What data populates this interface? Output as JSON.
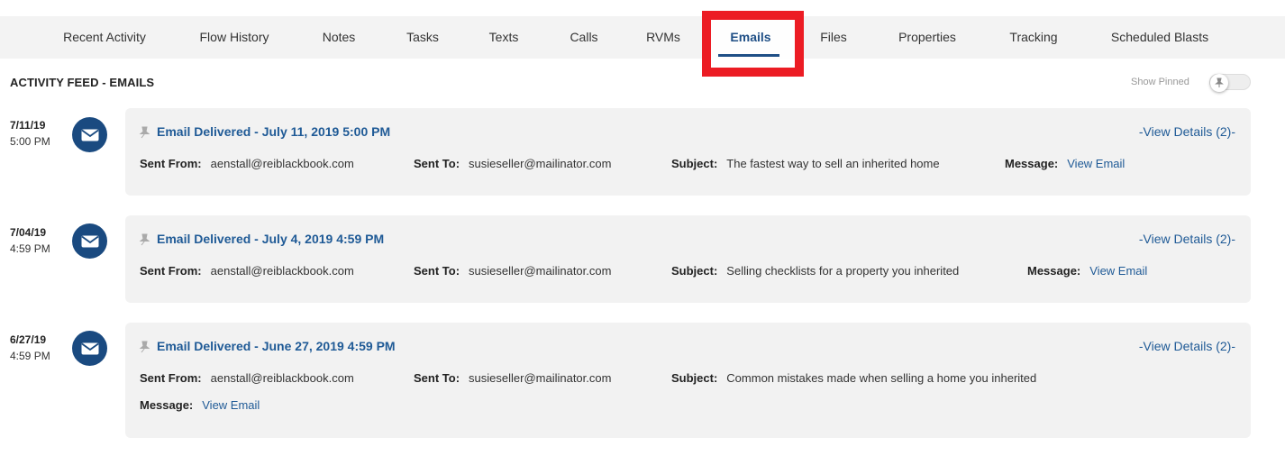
{
  "tabs": [
    {
      "label": "Recent Activity",
      "active": false
    },
    {
      "label": "Flow History",
      "active": false
    },
    {
      "label": "Notes",
      "active": false
    },
    {
      "label": "Tasks",
      "active": false
    },
    {
      "label": "Texts",
      "active": false
    },
    {
      "label": "Calls",
      "active": false
    },
    {
      "label": "RVMs",
      "active": false
    },
    {
      "label": "Emails",
      "active": true
    },
    {
      "label": "Files",
      "active": false
    },
    {
      "label": "Properties",
      "active": false
    },
    {
      "label": "Tracking",
      "active": false
    },
    {
      "label": "Scheduled Blasts",
      "active": false
    }
  ],
  "feed": {
    "title": "ACTIVITY FEED - EMAILS",
    "show_pinned_label": "Show Pinned",
    "show_pinned_on": false
  },
  "labels": {
    "sent_from": "Sent From:",
    "sent_to": "Sent To:",
    "subject": "Subject:",
    "message": "Message:",
    "view_email": "View Email",
    "view_details": "-View Details (2)-"
  },
  "entries": [
    {
      "date": "7/11/19",
      "time": "5:00 PM",
      "title": "Email Delivered - July 11, 2019 5:00 PM",
      "sent_from": "aenstall@reiblackbook.com",
      "sent_to": "susieseller@mailinator.com",
      "subject": "The fastest way to sell an inherited home"
    },
    {
      "date": "7/04/19",
      "time": "4:59 PM",
      "title": "Email Delivered - July 4, 2019 4:59 PM",
      "sent_from": "aenstall@reiblackbook.com",
      "sent_to": "susieseller@mailinator.com",
      "subject": "Selling checklists for a property you inherited"
    },
    {
      "date": "6/27/19",
      "time": "4:59 PM",
      "title": "Email Delivered - June 27, 2019 4:59 PM",
      "sent_from": "aenstall@reiblackbook.com",
      "sent_to": "susieseller@mailinator.com",
      "subject": "Common mistakes made when selling a home you inherited"
    }
  ],
  "colors": {
    "accent": "#1f5a96",
    "highlight": "#ec1c24",
    "card_bg": "#f2f2f2",
    "icon_bg": "#1a4a80"
  }
}
